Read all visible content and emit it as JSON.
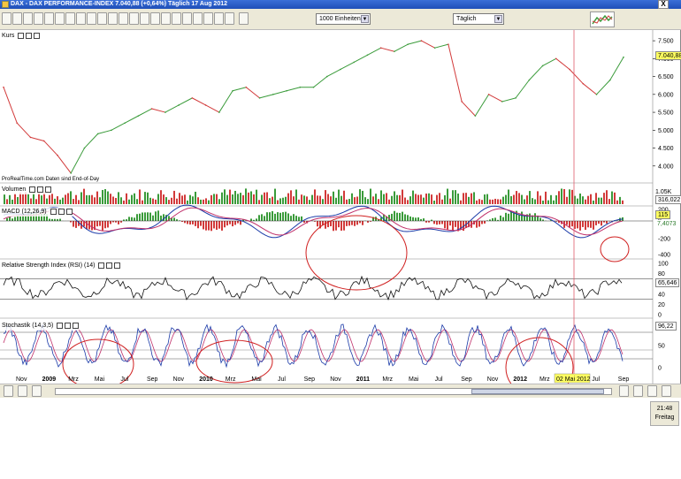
{
  "window": {
    "title": "DAX - DAX PERFORMANCE-INDEX   7.040,88 (+0,64%)  Täglich  17 Aug 2012",
    "close": "X"
  },
  "toolbar": {
    "units_select": "1000 Einheiten",
    "period_select": "Täglich",
    "dropdown_arrow": "▼"
  },
  "panels": {
    "kurs": {
      "label": "Kurs",
      "value": "7.040,88",
      "ticks": [
        "7.500",
        "7.000",
        "6.500",
        "6.000",
        "5.500",
        "5.000",
        "4.500",
        "4.000"
      ],
      "credit": "ProRealTime.com  Daten sind End-of-Day"
    },
    "volumen": {
      "label": "Volumen",
      "value": "316,022",
      "tick": "1.05K"
    },
    "macd": {
      "label": "MACD (12,26,9)",
      "value1": "115",
      "value2": "7,4073",
      "ticks": [
        "200",
        "0",
        "-200",
        "-400"
      ]
    },
    "rsi": {
      "label": "Relative Strength Index (RSI) (14)",
      "value": "65,646",
      "ticks": [
        "100",
        "80",
        "60",
        "40",
        "20",
        "0"
      ]
    },
    "stoch": {
      "label": "Stochastik (14,3,5)",
      "value": "96,22",
      "ticks": [
        "50",
        "0"
      ]
    }
  },
  "time_axis": {
    "labels": [
      "Nov",
      "2009",
      "Mrz",
      "Mai",
      "Jul",
      "Sep",
      "Nov",
      "2010",
      "Mrz",
      "Mai",
      "Jul",
      "Sep",
      "Nov",
      "2011",
      "Mrz",
      "Mai",
      "Jul",
      "Sep",
      "Nov",
      "2012",
      "Mrz",
      "Mai",
      "Jul",
      "Sep"
    ],
    "bold": [
      "2009",
      "2010",
      "2011",
      "2012"
    ],
    "cursor_label": "02 Mai 2012"
  },
  "status": {
    "time": "21:48",
    "day": "Freitag"
  },
  "colors": {
    "up": "#3a9b3a",
    "down": "#d23a3a",
    "macd_line": "#1a3aa8",
    "signal": "#c0306a",
    "circle": "#d02020",
    "cursor": "#e05a6a"
  },
  "chart_data": {
    "type": "line",
    "title": "DAX - DAX PERFORMANCE-INDEX",
    "x": [
      "2008-10",
      "2008-11",
      "2008-12",
      "2009-01",
      "2009-02",
      "2009-03",
      "2009-04",
      "2009-05",
      "2009-06",
      "2009-07",
      "2009-08",
      "2009-09",
      "2009-10",
      "2009-11",
      "2009-12",
      "2010-01",
      "2010-02",
      "2010-03",
      "2010-04",
      "2010-05",
      "2010-06",
      "2010-07",
      "2010-08",
      "2010-09",
      "2010-10",
      "2010-11",
      "2010-12",
      "2011-01",
      "2011-02",
      "2011-03",
      "2011-04",
      "2011-05",
      "2011-06",
      "2011-07",
      "2011-08",
      "2011-09",
      "2011-10",
      "2011-11",
      "2011-12",
      "2012-01",
      "2012-02",
      "2012-03",
      "2012-04",
      "2012-05",
      "2012-06",
      "2012-07",
      "2012-08"
    ],
    "series": [
      {
        "values": [
          6200,
          5200,
          4800,
          4700,
          4300,
          3800,
          4500,
          4900,
          5000,
          5200,
          5400,
          5600,
          5500,
          5700,
          5900,
          5700,
          5500,
          6100,
          6200,
          5900,
          6000,
          6100,
          6200,
          6200,
          6500,
          6700,
          6900,
          7100,
          7300,
          7200,
          7400,
          7500,
          7300,
          7400,
          5800,
          5400,
          6000,
          5800,
          5900,
          6400,
          6800,
          7000,
          6700,
          6300,
          6000,
          6400,
          7040
        ]
      }
    ],
    "ylim": [
      3600,
      7700
    ]
  }
}
